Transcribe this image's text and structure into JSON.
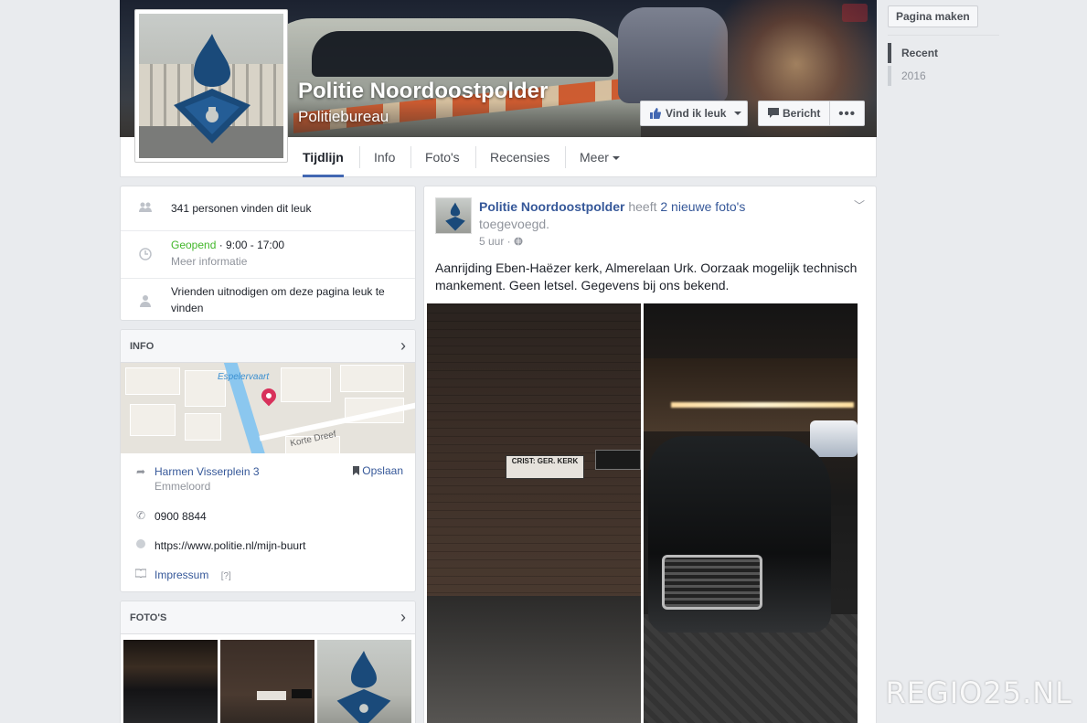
{
  "page": {
    "name": "Politie Noordoostpolder",
    "category": "Politiebureau"
  },
  "cover_buttons": {
    "like": "Vind ik leuk",
    "message": "Bericht",
    "more": "•••"
  },
  "tabs": [
    {
      "label": "Tijdlijn",
      "active": true
    },
    {
      "label": "Info"
    },
    {
      "label": "Foto's"
    },
    {
      "label": "Recensies"
    },
    {
      "label": "Meer"
    }
  ],
  "about": {
    "likes": "341 personen vinden dit leuk",
    "open_status": "Geopend",
    "hours": " · 9:00 - 17:00",
    "more_info": "Meer informatie",
    "invite": "Vrienden uitnodigen om deze pagina leuk te vinden"
  },
  "info_card": {
    "title": "INFO",
    "map_labels": {
      "canal": "Espelervaart",
      "street": "Korte Dreef"
    },
    "address_line1": "Harmen Visserplein 3",
    "address_line2": "Emmeloord",
    "save": "Opslaan",
    "phone": "0900 8844",
    "website": "https://www.politie.nl/mijn-buurt",
    "impressum": "Impressum",
    "impressum_hint": "[?]"
  },
  "photos_card": {
    "title": "FOTO'S"
  },
  "post": {
    "author": "Politie Noordoostpolder",
    "action_prefix": " heeft ",
    "action_link": "2 nieuwe foto's",
    "action_suffix": " toegevoegd.",
    "time": "5 uur · ",
    "text": "Aanrijding Eben-Haëzer kerk, Almerelaan Urk. Oorzaak mogelijk technisch mankement. Geen letsel. Gegevens bij ons bekend.",
    "sign_text": "CRIST: GER. KERK"
  },
  "right_col": {
    "create_page": "Pagina maken",
    "years": [
      "Recent",
      "2016"
    ]
  },
  "watermark": "REGIO25.NL",
  "colors": {
    "link": "#365899",
    "accent": "#4267b2",
    "open_green": "#42b72a",
    "police_blue": "#1a4a7a"
  }
}
